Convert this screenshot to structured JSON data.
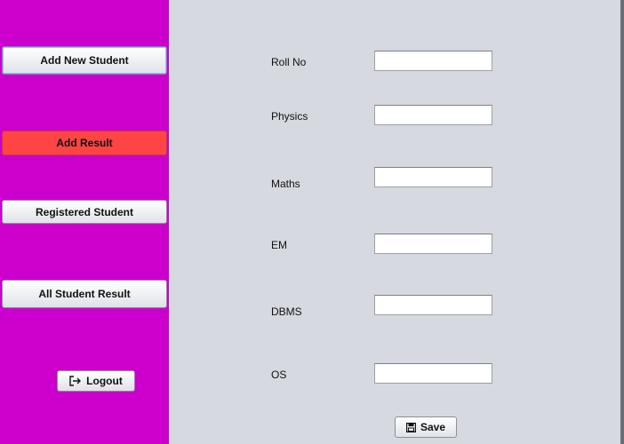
{
  "sidebar": {
    "add_new_student": "Add New Student",
    "add_result": "Add Result",
    "registered_student": "Registered Student",
    "all_student_result": "All Student Result",
    "logout": "Logout",
    "active_color": "#ff4444",
    "background": "#cc00cc"
  },
  "form": {
    "fields": [
      {
        "label": "Roll No",
        "value": ""
      },
      {
        "label": "Physics",
        "value": ""
      },
      {
        "label": "Maths",
        "value": ""
      },
      {
        "label": "EM",
        "value": ""
      },
      {
        "label": "DBMS",
        "value": ""
      },
      {
        "label": "OS",
        "value": ""
      }
    ],
    "save_label": "Save"
  },
  "icons": {
    "logout": "logout-arrow-icon",
    "save": "floppy-disk-icon"
  }
}
